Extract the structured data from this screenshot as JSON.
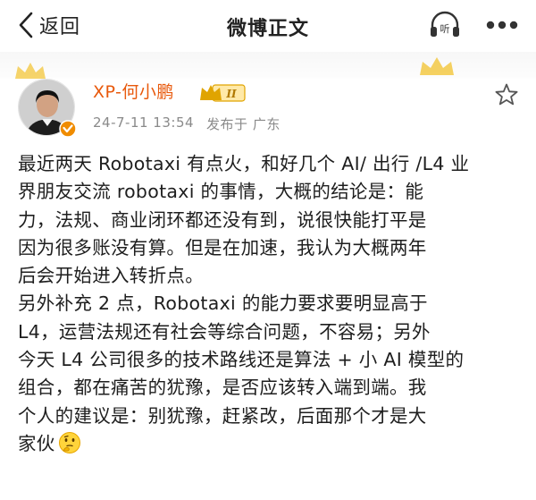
{
  "nav": {
    "back_label": "返回",
    "title": "微博正文",
    "listen_icon": "listen-headphones-icon",
    "more_icon": "more-dots-icon"
  },
  "post": {
    "author": {
      "name": "XP-何小鹏",
      "badge_level": "II",
      "verified": true
    },
    "date": "24-7-11 13:54",
    "location": "发布于 广东",
    "lines": [
      "最近两天 Robotaxi 有点火，和好几个 AI/ 出行 /L4 业",
      "界朋友交流 robotaxi 的事情，大概的结论是：能",
      "力，法规、商业闭环都还没有到，说很快能打平是",
      "因为很多账没有算。但是在加速，我认为大概两年",
      "后会开始进入转折点。",
      "另外补充 2 点，Robotaxi 的能力要求要明显高于",
      "L4，运营法规还有社会等综合问题，不容易；另外",
      "今天 L4 公司很多的技术路线还是算法 + 小 AI 模型的",
      "组合，都在痛苦的犹豫，是否应该转入端到端。我",
      "个人的建议是：别犹豫，赶紧改，后面那个才是大",
      "家伙"
    ],
    "emoji": "thinking-face-emoji"
  },
  "colors": {
    "username": "#e8590c",
    "meta": "#8a8a8a",
    "badge_gold": "#e0a400"
  }
}
